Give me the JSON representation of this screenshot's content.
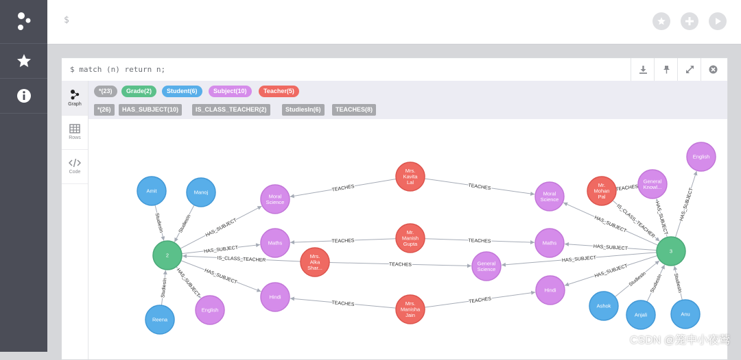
{
  "editor": {
    "prompt": "$"
  },
  "frame": {
    "query": "$ match (n) return n;"
  },
  "sidetabs": [
    {
      "label": "Graph"
    },
    {
      "label": "Rows"
    },
    {
      "label": "Code"
    }
  ],
  "legend": {
    "labels": [
      {
        "text": "*(23)",
        "color": "#a7a8ac"
      },
      {
        "text": "Grade(2)",
        "color": "#5bc08a"
      },
      {
        "text": "Student(6)",
        "color": "#58aee9"
      },
      {
        "text": "Subject(10)",
        "color": "#d58cea"
      },
      {
        "text": "Teacher(5)",
        "color": "#ef6a62"
      }
    ],
    "relationships": [
      {
        "text": "*(26)"
      },
      {
        "text": "HAS_SUBJECT(10)"
      },
      {
        "text": "IS_CLASS_TEACHER(2)"
      },
      {
        "text": "StudiesIn(6)"
      },
      {
        "text": "TEACHES(8)"
      }
    ]
  },
  "colors": {
    "Grade": "#5bc08a",
    "Student": "#58aee9",
    "Subject": "#d58cea",
    "Teacher": "#ef6a62"
  },
  "graph": {
    "nodes": [
      {
        "id": "amit",
        "label": "Student",
        "caption": [
          "Amit"
        ]
      },
      {
        "id": "manoj",
        "label": "Student",
        "caption": [
          "Manoj"
        ]
      },
      {
        "id": "g2",
        "label": "Grade",
        "caption": [
          "2"
        ]
      },
      {
        "id": "reena",
        "label": "Student",
        "caption": [
          "Reena"
        ]
      },
      {
        "id": "eng2",
        "label": "Subject",
        "caption": [
          "English"
        ]
      },
      {
        "id": "moral2",
        "label": "Subject",
        "caption": [
          "Moral",
          "Science"
        ]
      },
      {
        "id": "maths2",
        "label": "Subject",
        "caption": [
          "Maths"
        ]
      },
      {
        "id": "hindi2",
        "label": "Subject",
        "caption": [
          "Hindi"
        ]
      },
      {
        "id": "alka",
        "label": "Teacher",
        "caption": [
          "Mrs.",
          "Alka",
          "Shar..."
        ]
      },
      {
        "id": "kavita",
        "label": "Teacher",
        "caption": [
          "Mrs.",
          "Kavita",
          "Lal"
        ]
      },
      {
        "id": "manish",
        "label": "Teacher",
        "caption": [
          "Mr.",
          "Manish",
          "Gupta"
        ]
      },
      {
        "id": "manisha",
        "label": "Teacher",
        "caption": [
          "Mrs.",
          "Manisha",
          "Jain"
        ]
      },
      {
        "id": "gensci",
        "label": "Subject",
        "caption": [
          "General",
          "Science"
        ]
      },
      {
        "id": "moral3",
        "label": "Subject",
        "caption": [
          "Moral",
          "Science"
        ]
      },
      {
        "id": "maths3",
        "label": "Subject",
        "caption": [
          "Maths"
        ]
      },
      {
        "id": "hindi3",
        "label": "Subject",
        "caption": [
          "Hindi"
        ]
      },
      {
        "id": "mohan",
        "label": "Teacher",
        "caption": [
          "Mr.",
          "Mohan",
          "Pal"
        ]
      },
      {
        "id": "genknow",
        "label": "Subject",
        "caption": [
          "General",
          "Knowl..."
        ]
      },
      {
        "id": "eng3",
        "label": "Subject",
        "caption": [
          "English"
        ]
      },
      {
        "id": "g3",
        "label": "Grade",
        "caption": [
          "3"
        ]
      },
      {
        "id": "ashok",
        "label": "Student",
        "caption": [
          "Ashok"
        ]
      },
      {
        "id": "anjali",
        "label": "Student",
        "caption": [
          "Anjali"
        ]
      },
      {
        "id": "anu",
        "label": "Student",
        "caption": [
          "Anu"
        ]
      }
    ],
    "relationships": [
      {
        "from": "amit",
        "to": "g2",
        "type": "StudiesIn"
      },
      {
        "from": "manoj",
        "to": "g2",
        "type": "StudiesIn"
      },
      {
        "from": "reena",
        "to": "g2",
        "type": "StudiesIn"
      },
      {
        "from": "g2",
        "to": "moral2",
        "type": "HAS_SUBJECT"
      },
      {
        "from": "g2",
        "to": "maths2",
        "type": "HAS_SUBJECT"
      },
      {
        "from": "g2",
        "to": "hindi2",
        "type": "HAS_SUBJECT"
      },
      {
        "from": "g2",
        "to": "eng2",
        "type": "HAS_SUBJECT"
      },
      {
        "from": "alka",
        "to": "g2",
        "type": "IS_CLASS_TEACHER"
      },
      {
        "from": "kavita",
        "to": "moral2",
        "type": "TEACHES"
      },
      {
        "from": "kavita",
        "to": "moral3",
        "type": "TEACHES"
      },
      {
        "from": "manish",
        "to": "maths2",
        "type": "TEACHES"
      },
      {
        "from": "manish",
        "to": "maths3",
        "type": "TEACHES"
      },
      {
        "from": "manisha",
        "to": "hindi2",
        "type": "TEACHES"
      },
      {
        "from": "manisha",
        "to": "hindi3",
        "type": "TEACHES"
      },
      {
        "from": "alka",
        "to": "gensci",
        "type": "TEACHES"
      },
      {
        "from": "mohan",
        "to": "genknow",
        "type": "TEACHES"
      },
      {
        "from": "mohan",
        "to": "g3",
        "type": "IS_CLASS_TEACHER"
      },
      {
        "from": "g3",
        "to": "moral3",
        "type": "HAS_SUBJECT"
      },
      {
        "from": "g3",
        "to": "maths3",
        "type": "HAS_SUBJECT"
      },
      {
        "from": "g3",
        "to": "gensci",
        "type": "HAS_SUBJECT"
      },
      {
        "from": "g3",
        "to": "hindi3",
        "type": "HAS_SUBJECT"
      },
      {
        "from": "g3",
        "to": "genknow",
        "type": "HAS_SUBJECT"
      },
      {
        "from": "g3",
        "to": "eng3",
        "type": "HAS_SUBJECT"
      },
      {
        "from": "ashok",
        "to": "g3",
        "type": "StudiesIn"
      },
      {
        "from": "anjali",
        "to": "g3",
        "type": "StudiesIn"
      },
      {
        "from": "anu",
        "to": "g3",
        "type": "StudiesIn"
      }
    ]
  },
  "watermark": "CSDN @笼中小夜莺"
}
